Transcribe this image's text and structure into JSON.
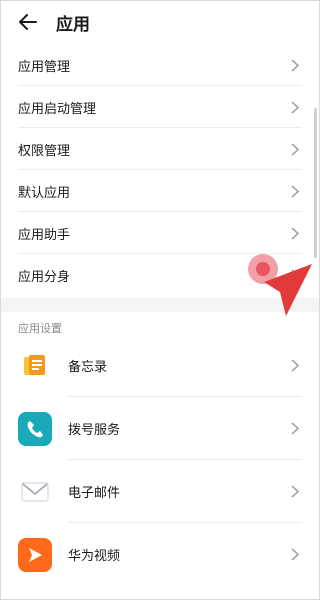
{
  "header": {
    "title": "应用"
  },
  "menu_items": [
    {
      "label": "应用管理"
    },
    {
      "label": "应用启动管理"
    },
    {
      "label": "权限管理"
    },
    {
      "label": "默认应用"
    },
    {
      "label": "应用助手"
    },
    {
      "label": "应用分身"
    }
  ],
  "section": {
    "label": "应用设置"
  },
  "apps": [
    {
      "name": "备忘录",
      "icon": "memo-icon",
      "color": "#f39a1e"
    },
    {
      "name": "拨号服务",
      "icon": "phone-icon",
      "color": "#1aa9b8"
    },
    {
      "name": "电子邮件",
      "icon": "mail-icon",
      "color": "#ffffff"
    },
    {
      "name": "华为视频",
      "icon": "video-icon",
      "color": "#ff6a1a"
    }
  ],
  "colors": {
    "accent": "#e03a3a",
    "divider": "#ececec"
  }
}
